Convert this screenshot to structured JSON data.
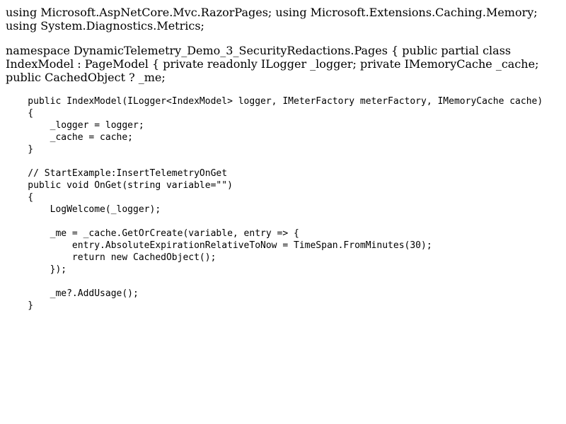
{
  "paragraphs": {
    "usings": "using Microsoft.AspNetCore.Mvc.RazorPages; using Microsoft.Extensions.Caching.Memory; using System.Diagnostics.Metrics;",
    "namespace_decl": "namespace DynamicTelemetry_Demo_3_SecurityRedactions.Pages { public partial class IndexModel : PageModel { private readonly ILogger _logger; private IMemoryCache _cache; public CachedObject ? _me;"
  },
  "code_lines": [
    "    public IndexModel(ILogger<IndexModel> logger, IMeterFactory meterFactory, IMemoryCache cache)",
    "    {",
    "        _logger = logger;",
    "        _cache = cache;",
    "    }",
    "",
    "    // StartExample:InsertTelemetryOnGet",
    "    public void OnGet(string variable=\"\")",
    "    {",
    "        LogWelcome(_logger);",
    "",
    "        _me = _cache.GetOrCreate(variable, entry => {",
    "            entry.AbsoluteExpirationRelativeToNow = TimeSpan.FromMinutes(30);",
    "            return new CachedObject();",
    "        });",
    "",
    "        _me?.AddUsage();",
    "    }"
  ]
}
